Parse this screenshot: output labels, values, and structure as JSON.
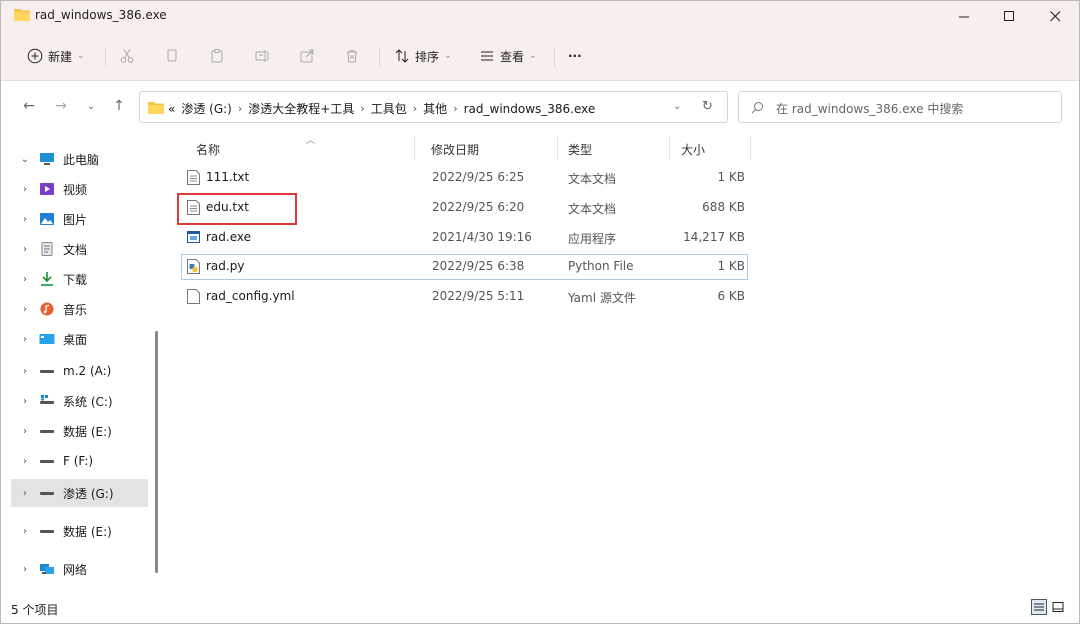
{
  "window": {
    "title": "rad_windows_386.exe"
  },
  "toolbar": {
    "new_label": "新建",
    "sort_label": "排序",
    "view_label": "查看",
    "more_label": "···"
  },
  "address": {
    "overflow": "«",
    "crumbs": [
      "渗透 (G:)",
      "渗透大全教程+工具",
      "工具包",
      "其他",
      "rad_windows_386.exe"
    ]
  },
  "search": {
    "placeholder": "在 rad_windows_386.exe 中搜索"
  },
  "sidebar": {
    "items": [
      {
        "label": "此电脑",
        "icon": "pc-icon",
        "expanded": true
      },
      {
        "label": "视频",
        "icon": "video-icon"
      },
      {
        "label": "图片",
        "icon": "pictures-icon"
      },
      {
        "label": "文档",
        "icon": "documents-icon"
      },
      {
        "label": "下载",
        "icon": "download-icon"
      },
      {
        "label": "音乐",
        "icon": "music-icon"
      },
      {
        "label": "桌面",
        "icon": "desktop-icon"
      },
      {
        "label": "m.2 (A:)",
        "icon": "drive-icon"
      },
      {
        "label": "系统 (C:)",
        "icon": "system-drive-icon"
      },
      {
        "label": "数据 (E:)",
        "icon": "drive-icon"
      },
      {
        "label": "F (F:)",
        "icon": "drive-icon"
      },
      {
        "label": "渗透 (G:)",
        "icon": "drive-icon",
        "selected": true
      },
      {
        "label": "数据 (E:)",
        "icon": "drive-icon"
      },
      {
        "label": "网络",
        "icon": "network-icon"
      }
    ]
  },
  "columns": {
    "name": "名称",
    "date": "修改日期",
    "type": "类型",
    "size": "大小"
  },
  "files": [
    {
      "name": "111.txt",
      "date": "2022/9/25 6:25",
      "type": "文本文档",
      "size": "1 KB",
      "icon": "text-file-icon"
    },
    {
      "name": "edu.txt",
      "date": "2022/9/25 6:20",
      "type": "文本文档",
      "size": "688 KB",
      "icon": "text-file-icon"
    },
    {
      "name": "rad.exe",
      "date": "2021/4/30 19:16",
      "type": "应用程序",
      "size": "14,217 KB",
      "icon": "exe-file-icon"
    },
    {
      "name": "rad.py",
      "date": "2022/9/25 6:38",
      "type": "Python File",
      "size": "1 KB",
      "icon": "python-file-icon"
    },
    {
      "name": "rad_config.yml",
      "date": "2022/9/25 5:11",
      "type": "Yaml 源文件",
      "size": "6 KB",
      "icon": "file-icon"
    }
  ],
  "status": {
    "count": "5 个项目"
  },
  "colors": {
    "titlebar": "#f7eeee",
    "accent": "#0067c0",
    "highlight": "#e0393b",
    "folder": "#f5c242"
  }
}
